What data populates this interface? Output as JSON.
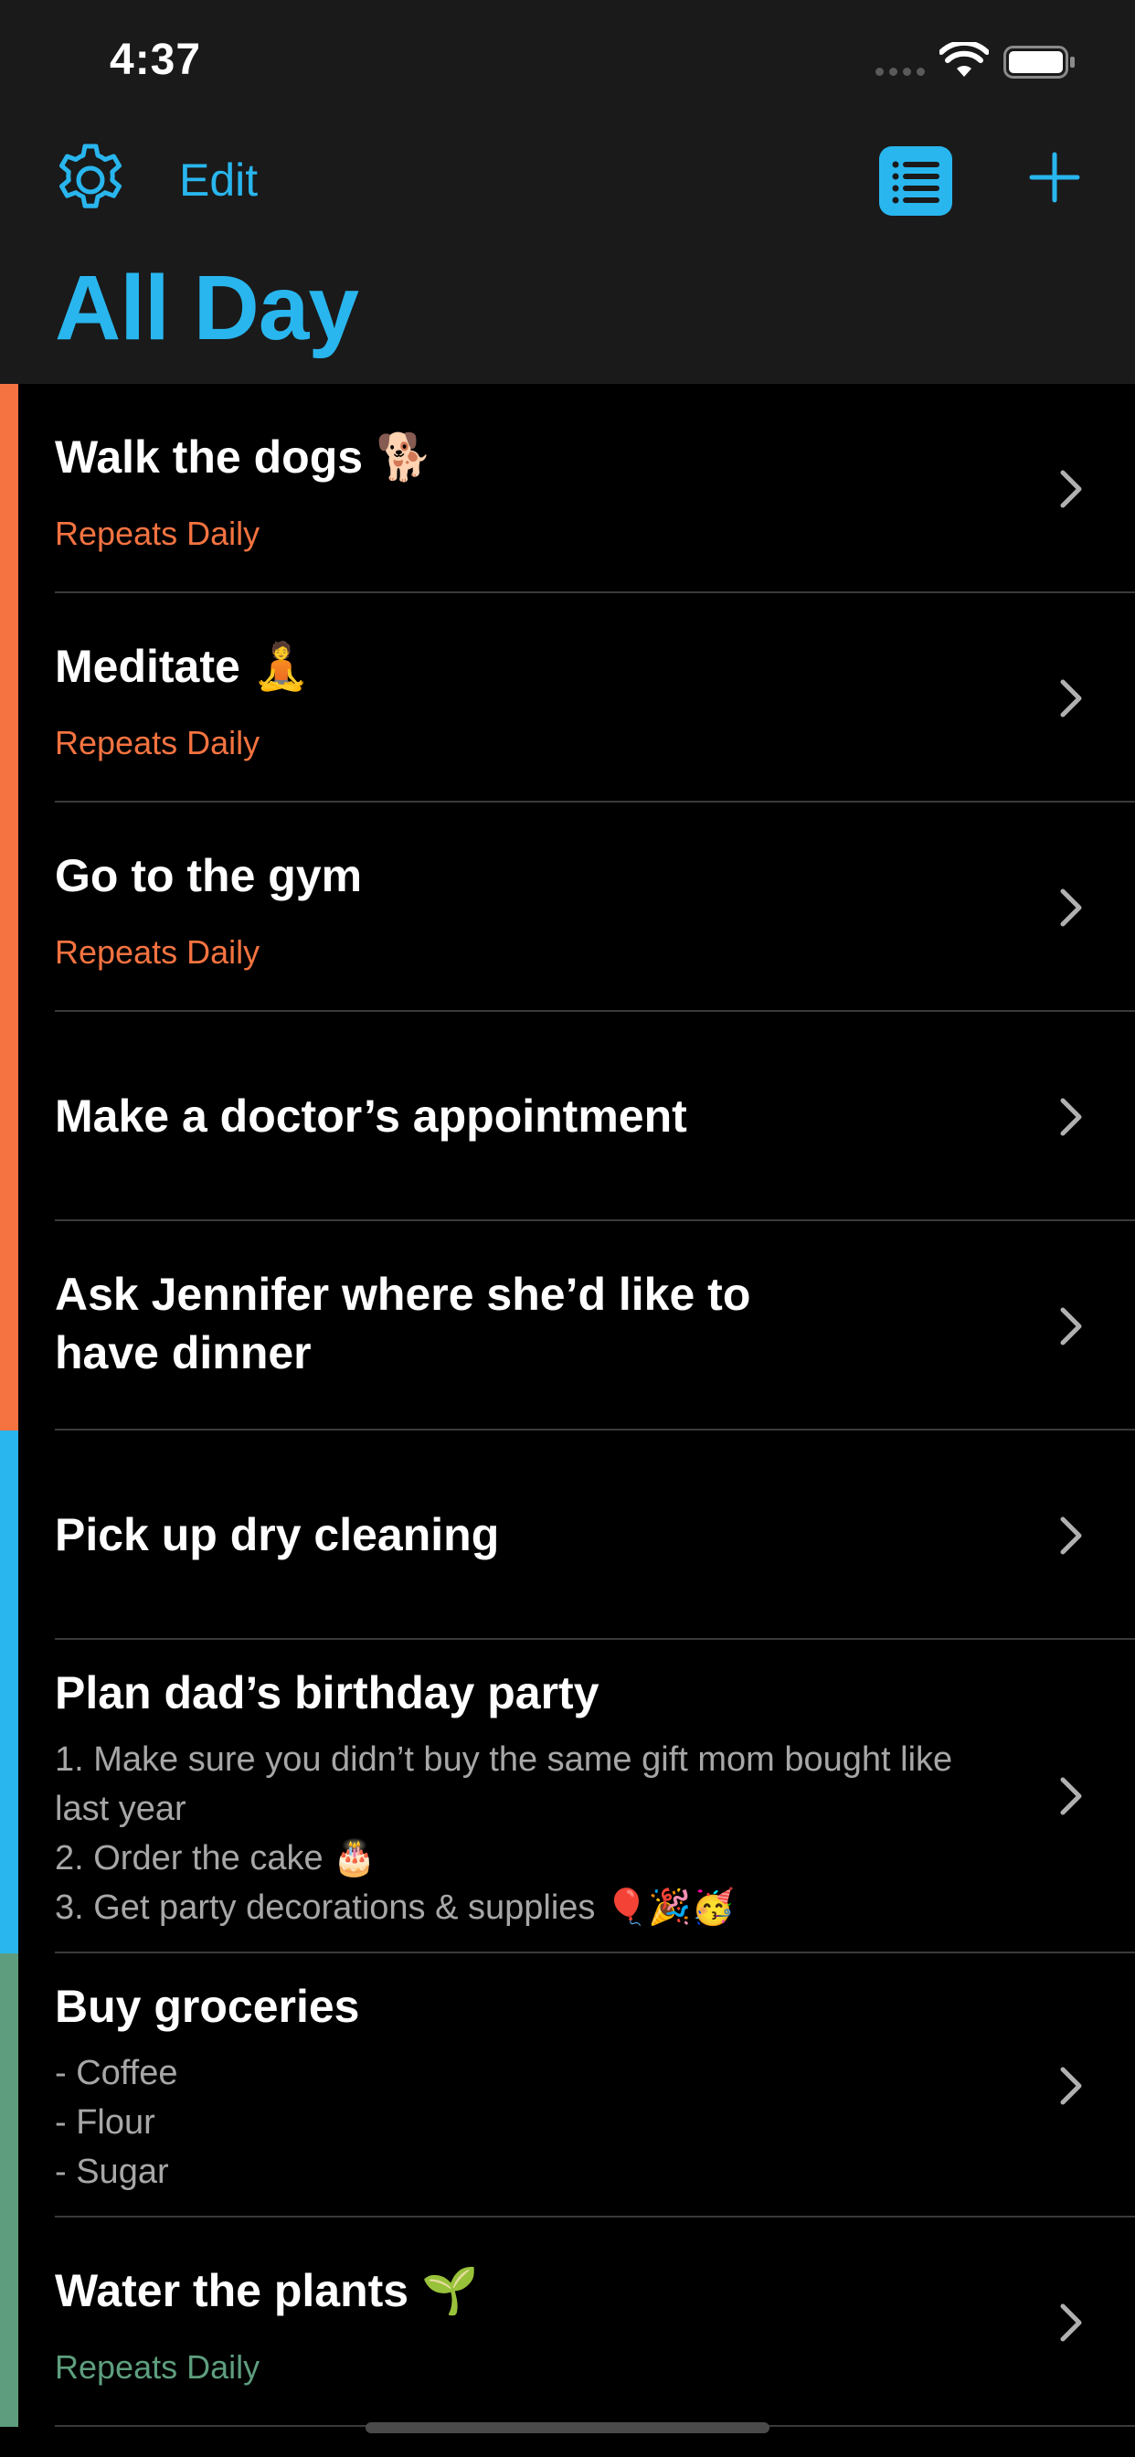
{
  "status_bar": {
    "time": "4:37"
  },
  "nav": {
    "edit_label": "Edit",
    "title": "All Day",
    "accent_color": "#29b6ee",
    "icons": [
      "gear-icon",
      "list-view-icon",
      "plus-icon"
    ]
  },
  "tasks": [
    {
      "title": "Walk the dogs 🐕",
      "subtitle": "Repeats Daily",
      "notes": "",
      "color": "#f47340",
      "subtitle_color": "#f47340"
    },
    {
      "title": "Meditate 🧘",
      "subtitle": "Repeats Daily",
      "notes": "",
      "color": "#f47340",
      "subtitle_color": "#f47340"
    },
    {
      "title": "Go to the gym",
      "subtitle": "Repeats Daily",
      "notes": "",
      "color": "#f47340",
      "subtitle_color": "#f47340"
    },
    {
      "title": "Make a doctor’s appointment",
      "subtitle": "",
      "notes": "",
      "color": "#f47340",
      "subtitle_color": "#f47340"
    },
    {
      "title": "Ask Jennifer where she’d like to have dinner",
      "subtitle": "",
      "notes": "",
      "color": "#f47340",
      "subtitle_color": "#f47340"
    },
    {
      "title": "Pick up dry cleaning",
      "subtitle": "",
      "notes": "",
      "color": "#29b6ee",
      "subtitle_color": "#29b6ee"
    },
    {
      "title": "Plan dad’s birthday party",
      "subtitle": "",
      "notes": "1. Make sure you didn’t buy the same gift mom bought like last year\n2. Order the cake 🎂\n3. Get party decorations & supplies 🎈🎉🥳",
      "color": "#29b6ee",
      "subtitle_color": "#29b6ee"
    },
    {
      "title": "Buy groceries",
      "subtitle": "",
      "notes": "- Coffee\n- Flour\n- Sugar",
      "color": "#5e9e7e",
      "subtitle_color": "#5e9e7e"
    },
    {
      "title": "Water the plants 🌱",
      "subtitle": "Repeats Daily",
      "notes": "",
      "color": "#5e9e7e",
      "subtitle_color": "#5e9e7e"
    }
  ]
}
